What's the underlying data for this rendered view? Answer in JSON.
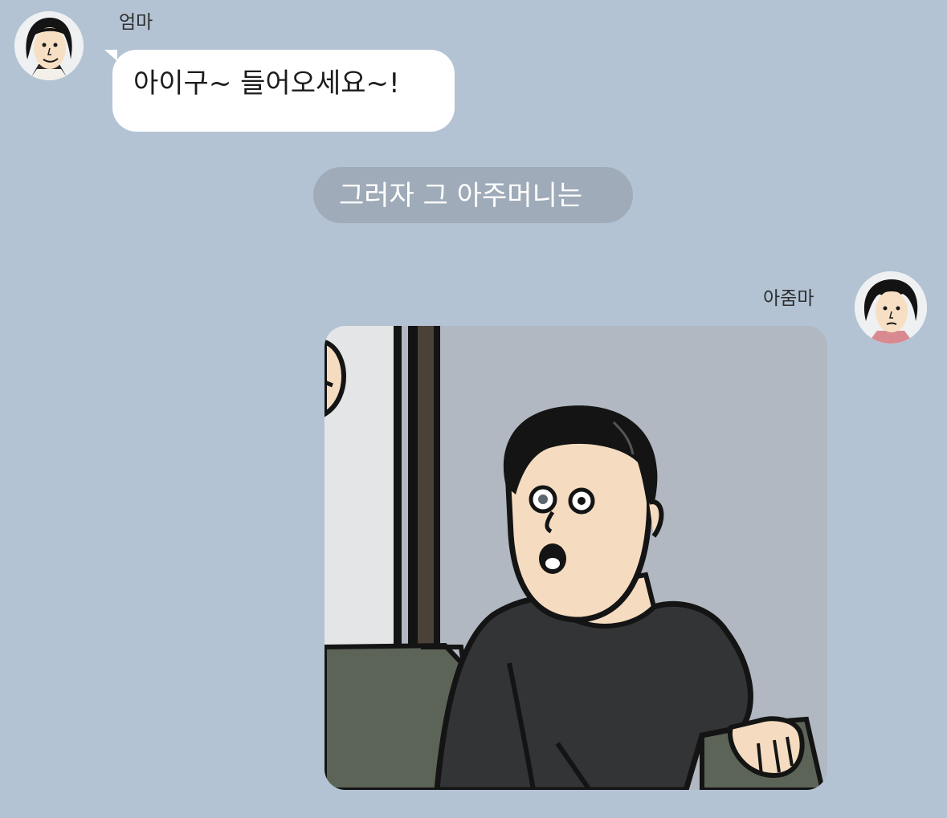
{
  "messages": [
    {
      "sender": "엄마",
      "text": "아이구~ 들어오세요~!"
    },
    {
      "system_text": "그러자 그 아주머니는"
    },
    {
      "sender": "아줌마",
      "attachment": "cartoon-image-man-surprised"
    }
  ],
  "colors": {
    "background": "#b3c3d4",
    "bubble": "#ffffff",
    "system_pill": "#9fabb8"
  }
}
